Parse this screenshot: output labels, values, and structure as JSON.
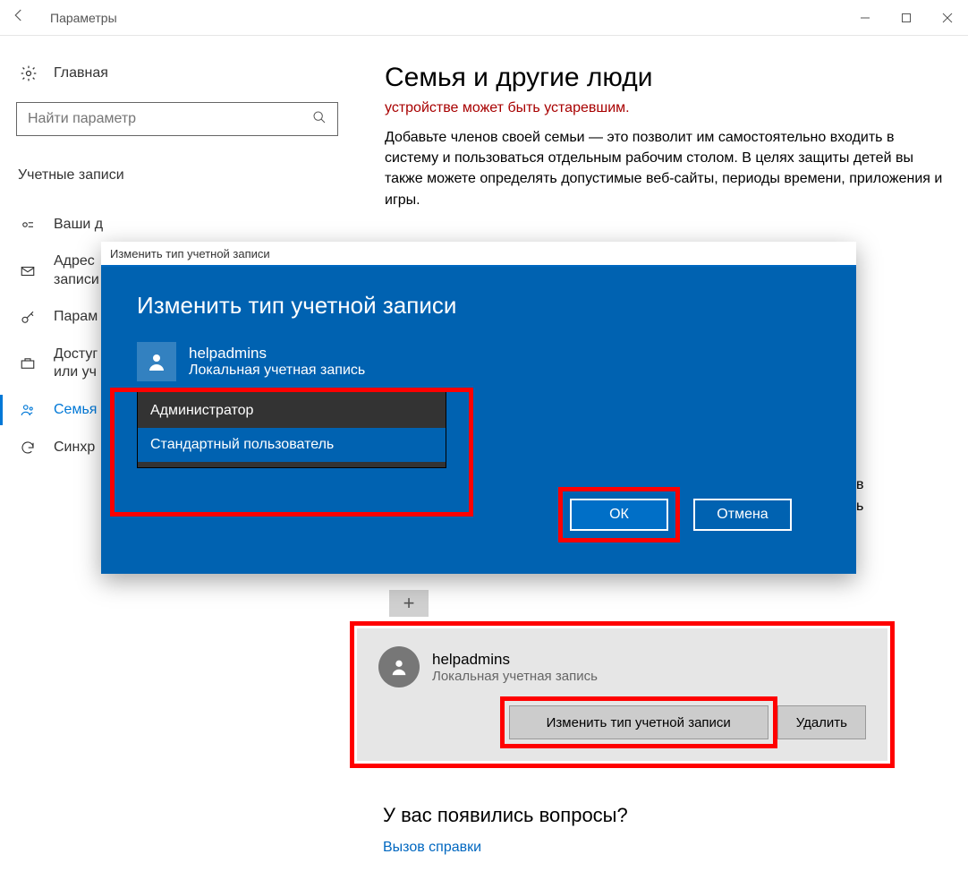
{
  "titlebar": {
    "title": "Параметры"
  },
  "left": {
    "home": "Главная",
    "search_placeholder": "Найти параметр",
    "section": "Учетные записи",
    "items": [
      {
        "label": "Ваши д"
      },
      {
        "label": "Адрес\nзаписи"
      },
      {
        "label": "Парам"
      },
      {
        "label": "Достуг\nили уч"
      },
      {
        "label": "Семья"
      },
      {
        "label": "Синхр"
      }
    ]
  },
  "right": {
    "title": "Семья и другие люди",
    "warn": "устройстве может быть устаревшим.",
    "desc": "Добавьте членов своей семьи — это позволит им самостоятельно входить в систему и пользоваться отдельным рабочим столом. В целях защиты детей вы также можете определять допустимые веб-сайты, периоды времени, приложения и игры.",
    "frag1": "в",
    "frag2": "ь"
  },
  "modal": {
    "titlebar": "Изменить тип учетной записи",
    "heading": "Изменить тип учетной записи",
    "user": {
      "name": "helpadmins",
      "type": "Локальная учетная запись"
    },
    "options": {
      "admin": "Администратор",
      "standard": "Стандартный пользователь"
    },
    "ok": "ОК",
    "cancel": "Отмена"
  },
  "user_card": {
    "name": "helpadmins",
    "type": "Локальная учетная запись",
    "change": "Изменить тип учетной записи",
    "delete": "Удалить"
  },
  "questions": {
    "heading": "У вас появились вопросы?",
    "link": "Вызов справки"
  },
  "plus": "+"
}
